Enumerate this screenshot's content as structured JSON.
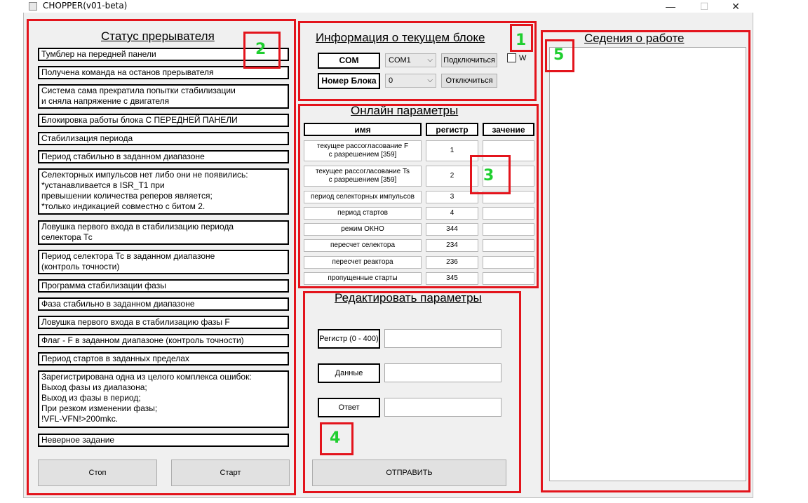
{
  "window": {
    "title": "CHOPPER(v01-beta)",
    "minimize": "—",
    "maximize": "☐",
    "close": "✕"
  },
  "annotations": [
    "1",
    "2",
    "3",
    "4",
    "5"
  ],
  "status_panel": {
    "title": "Статус прерывателя",
    "items": [
      "Тумблер на передней панели",
      "Получена команда на останов прерывателя",
      "Система сама  прекратила попытки стабилизации\nи сняла напряжение с двигателя",
      "Блокировка работы блока С ПЕРЕДНЕЙ ПАНЕЛИ",
      "Стабилизация периода",
      "Период стабильно в заданном диапазоне",
      "Селекторных импульсов нет либо они не появились:\n*устанавливается в ISR_T1 при\n превышении количества реперов является;\n*только индикацией совместно с битом 2.",
      "Ловушка первого входа в  стабилизацию периода\nселектора Тс",
      "Период селектора Тс в заданном диапазоне\n(контроль точности)",
      "Программа стабилизации фазы",
      "Фаза   стабильно в заданном диапазоне",
      "Ловушка первого входа в  стабилизацию фазы  F",
      "Флаг - F в заданном диапазоне (контроль точности)",
      "Период стартов в заданных пределах",
      "Зарегистрирована одна из целого комплекса ошибок:\nВыход  фазы из диапазона;\nВыход  из фазы в период;\nПри резком изменении фазы;\n!VFL-VFN!>200mkc.",
      "Неверное задание"
    ],
    "stop_label": "Стоп",
    "start_label": "Старт"
  },
  "block_info": {
    "title": "Информация о текущем блоке",
    "com_label": "COM",
    "com_value": "COM1",
    "block_label": "Номер Блока",
    "block_value": "0",
    "connect_label": "Подключиться",
    "disconnect_label": "Отключиться",
    "w_label": "W"
  },
  "online": {
    "title": "Онлайн параметры",
    "headers": [
      "имя",
      "регистр",
      "зачение"
    ],
    "rows": [
      {
        "name": "текущее рассогласование F\nс разрешением [359]",
        "reg": "1",
        "val": ""
      },
      {
        "name": "текущее рассогласование Ts\nс разрешением [359]",
        "reg": "2",
        "val": ""
      },
      {
        "name": "период селекторных импульсов",
        "reg": "3",
        "val": ""
      },
      {
        "name": "период стартов",
        "reg": "4",
        "val": ""
      },
      {
        "name": "режим ОКНО",
        "reg": "344",
        "val": ""
      },
      {
        "name": "пересчет селектора",
        "reg": "234",
        "val": ""
      },
      {
        "name": "пересчет реактора",
        "reg": "236",
        "val": ""
      },
      {
        "name": "пропущенные старты",
        "reg": "345",
        "val": ""
      }
    ]
  },
  "edit": {
    "title": "Редактировать параметры",
    "register_label": "Регистр (0 - 400)",
    "data_label": "Данные",
    "answer_label": "Ответ",
    "register_value": "",
    "data_value": "",
    "answer_value": "",
    "send_label": "ОТПРАВИТЬ"
  },
  "log": {
    "title": "Седения о работе",
    "content": ""
  },
  "colors": {
    "annotation_box": "#e3141c",
    "annotation_number": "#1fce2f"
  }
}
